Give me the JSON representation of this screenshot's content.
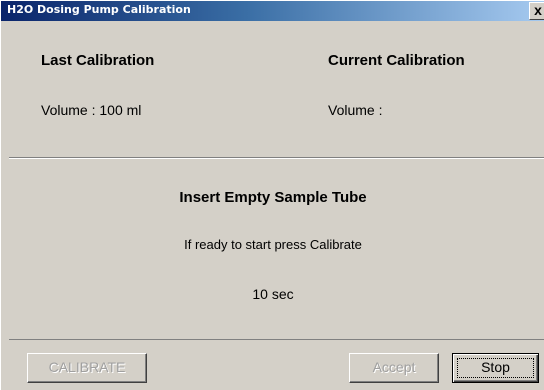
{
  "window": {
    "title": "H2O Dosing Pump Calibration",
    "close_label": "x"
  },
  "last_calibration": {
    "heading": "Last Calibration",
    "volume_text": "Volume : 100 ml"
  },
  "current_calibration": {
    "heading": "Current Calibration",
    "volume_text": "Volume :"
  },
  "instructions": {
    "headline": "Insert Empty Sample Tube",
    "message": "If ready to start press Calibrate",
    "timer": "10 sec"
  },
  "buttons": {
    "calibrate_label": "CALIBRATE",
    "calibrate_enabled": false,
    "accept_label": "Accept",
    "accept_enabled": false,
    "stop_label": "Stop",
    "stop_enabled": true
  }
}
